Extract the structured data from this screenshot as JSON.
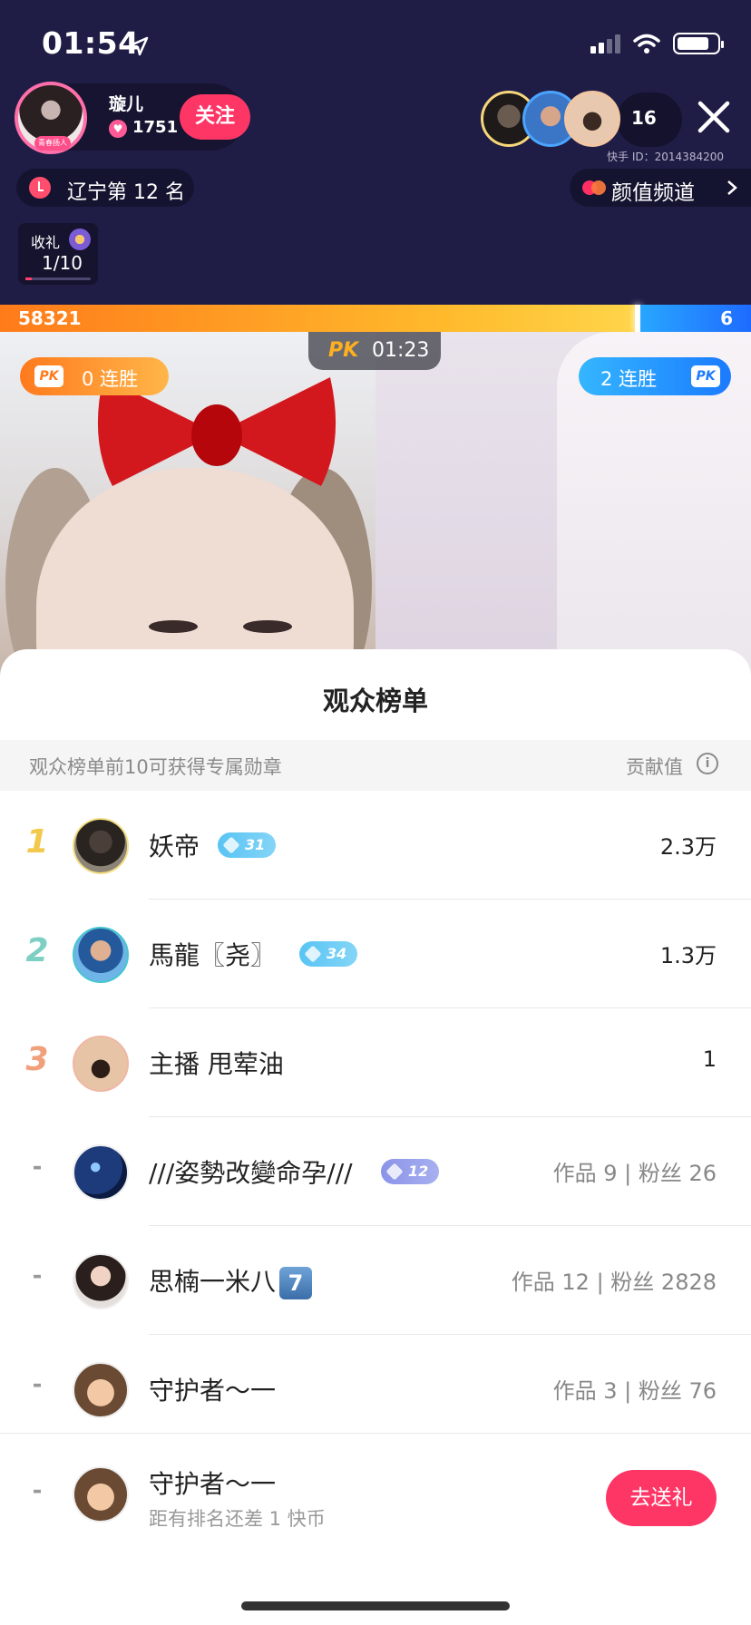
{
  "status_bar": {
    "time": "01:54"
  },
  "host": {
    "name": "璇儿",
    "badge": "青春扬人",
    "likes": "1751",
    "follow_label": "关注"
  },
  "viewers": {
    "count": "16",
    "kuaishou_id": "快手 ID：2014384200"
  },
  "rank_pill": {
    "text": "辽宁第 12 名"
  },
  "channel_pill": {
    "text": "颜值频道"
  },
  "gift_box": {
    "label": "收礼",
    "count": "1/10",
    "progress": 0.1
  },
  "pk": {
    "left_score": "58321",
    "right_score": "6",
    "left_share": 0.846,
    "logo": "PK",
    "timer": "01:23",
    "left_streak": "0  连胜",
    "right_streak": "2  连胜"
  },
  "leaderboard": {
    "title": "观众榜单",
    "hint": "观众榜单前10可获得专属勋章",
    "value_label": "贡献值",
    "rows": [
      {
        "rank": "1",
        "name": "妖帝",
        "level": "31",
        "value": "2.3万"
      },
      {
        "rank": "2",
        "name": "馬龍〖尧〗",
        "level": "34",
        "value": "1.3万"
      },
      {
        "rank": "3",
        "name": "主播 甩荤油",
        "value": "1"
      },
      {
        "rank": "-",
        "name": "///姿勢改變命孕///",
        "level": "12",
        "stats": "作品 9 | 粉丝 26"
      },
      {
        "rank": "-",
        "name": "思楠一米八",
        "badge_num": "7",
        "stats": "作品 12 | 粉丝 2828"
      },
      {
        "rank": "-",
        "name": "守护者～一",
        "stats": "作品 3 | 粉丝 76"
      }
    ],
    "self": {
      "rank": "-",
      "name": "守护者～一",
      "sub": "距有排名还差 1 快币",
      "button": "去送礼"
    }
  },
  "colors": {
    "accent_pink": "#fe3666",
    "pk_orange": "#ff7b1a",
    "pk_blue": "#1e6bff",
    "rank1": "#f2c94c",
    "rank2": "#7ccfc2",
    "rank3": "#f0a07a"
  },
  "icons": [
    "location-arrow-icon",
    "signal-icon",
    "wifi-icon",
    "battery-icon",
    "heart-icon",
    "close-icon",
    "clock-icon",
    "channel-logo-icon",
    "chevron-right-icon",
    "gift-icon",
    "pk-badge-icon",
    "gem-icon",
    "info-icon"
  ]
}
